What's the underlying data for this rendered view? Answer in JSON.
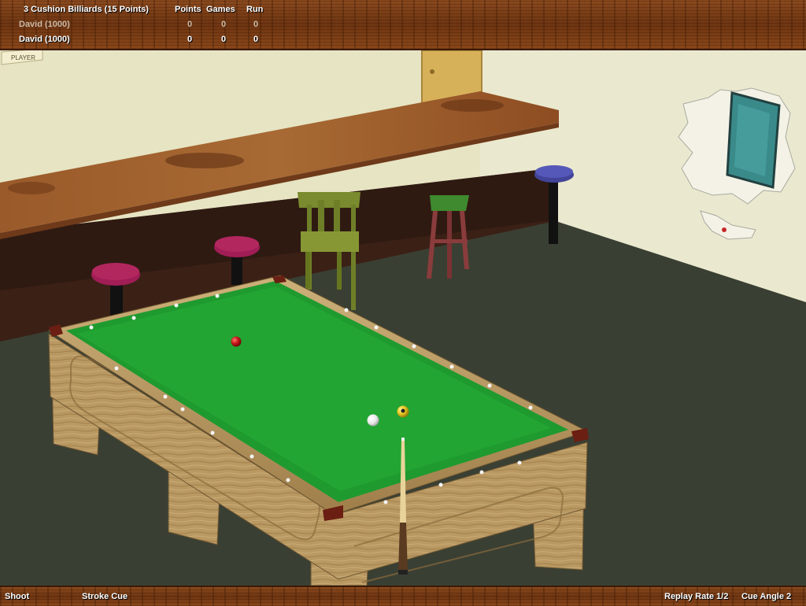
{
  "scoreboard": {
    "game_title": "3 Cushion Billiards  (15 Points)",
    "col_points": "Points",
    "col_games": "Games",
    "col_run": "Run",
    "players": [
      {
        "name": "David  (1000)",
        "points": "0",
        "games": "0",
        "run": "0",
        "active": false
      },
      {
        "name": "David  (1000)",
        "points": "0",
        "games": "0",
        "run": "0",
        "active": true
      }
    ]
  },
  "wall_sign": "PLAYER",
  "statusbar": {
    "shoot": "Shoot",
    "stroke_cue": "Stroke Cue",
    "replay_rate": "Replay Rate 1/2",
    "cue_angle": "Cue Angle  2"
  },
  "colors": {
    "felt": "#1f9a2e",
    "wall": "#e6e4c3",
    "floor": "#3a3f33",
    "red_ball": "#c4161a",
    "yellow_ball": "#e6c81e",
    "white_ball": "#f4f4f4",
    "stool_magenta": "#a01d55",
    "stool_blue": "#42449a",
    "chair_olive": "#7a8a2e",
    "stool_green": "#3f8a2e"
  }
}
